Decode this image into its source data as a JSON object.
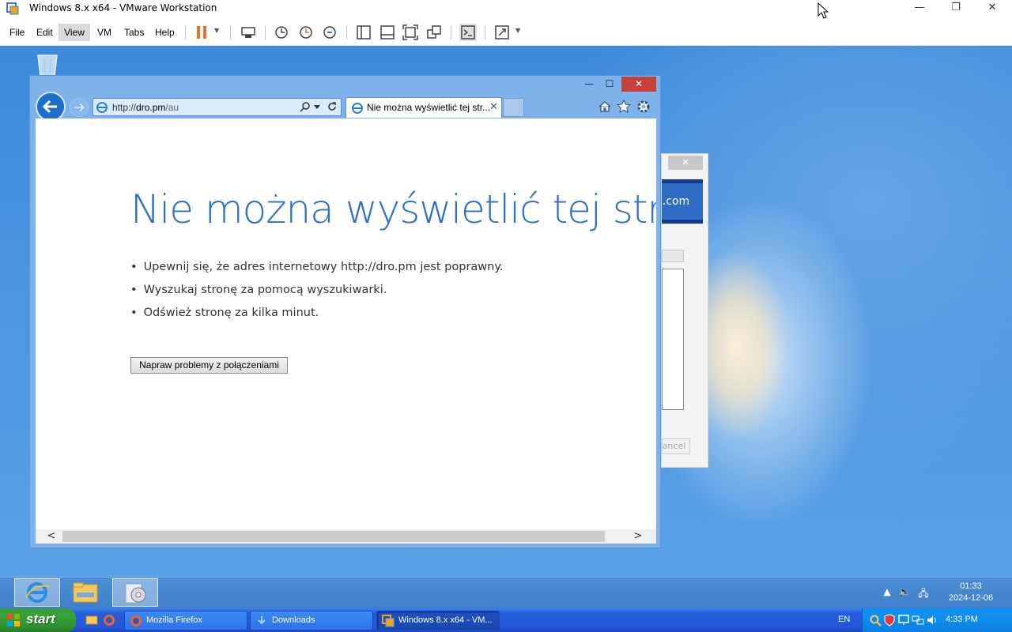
{
  "vmware": {
    "title": "Windows 8.x x64 - VMware Workstation",
    "menus": [
      "File",
      "Edit",
      "View",
      "VM",
      "Tabs",
      "Help"
    ],
    "active_menu": "View",
    "controls": {
      "minimize": "—",
      "restore": "❐",
      "close": "✕"
    }
  },
  "ie": {
    "window_controls": {
      "minimize": "—",
      "maximize": "☐",
      "close": "✕"
    },
    "address": {
      "prefix": "http://",
      "host": "dro.pm",
      "path": "/au"
    },
    "tab": {
      "title": "Nie można wyświetlić tej str...",
      "close": "✕"
    },
    "content": {
      "heading": "Nie można wyświetlić tej strony",
      "bullets": [
        "Upewnij się, że adres internetowy http://dro.pm jest poprawny.",
        "Wyszukaj stronę za pomocą wyszukiwarki.",
        "Odśwież stronę za kilka minut."
      ],
      "fix_button": "Napraw problemy z połączeniami"
    },
    "scroll": {
      "left": "<",
      "right": ">"
    }
  },
  "background_dialog": {
    "banner_text": "ts.com",
    "cancel_text": "Cancel",
    "close": "✕"
  },
  "guest_taskbar": {
    "clock_time": "01:33",
    "clock_date": "2024-12-06"
  },
  "host_taskbar": {
    "start_label": "start",
    "tasks": [
      {
        "label": "Mozilla Firefox",
        "icon": "firefox-icon"
      },
      {
        "label": "Downloads",
        "icon": "folder-icon"
      },
      {
        "label": "Windows 8.x x64 - VM...",
        "icon": "vmware-icon"
      }
    ],
    "lang": "EN",
    "clock": "4:33 PM"
  },
  "colors": {
    "ie_heading": "#2a6fce",
    "ie_frame": "#7fb2ea",
    "ie_close": "#c7403a",
    "xp_taskbar": "#245edb",
    "xp_start": "#36a336"
  }
}
